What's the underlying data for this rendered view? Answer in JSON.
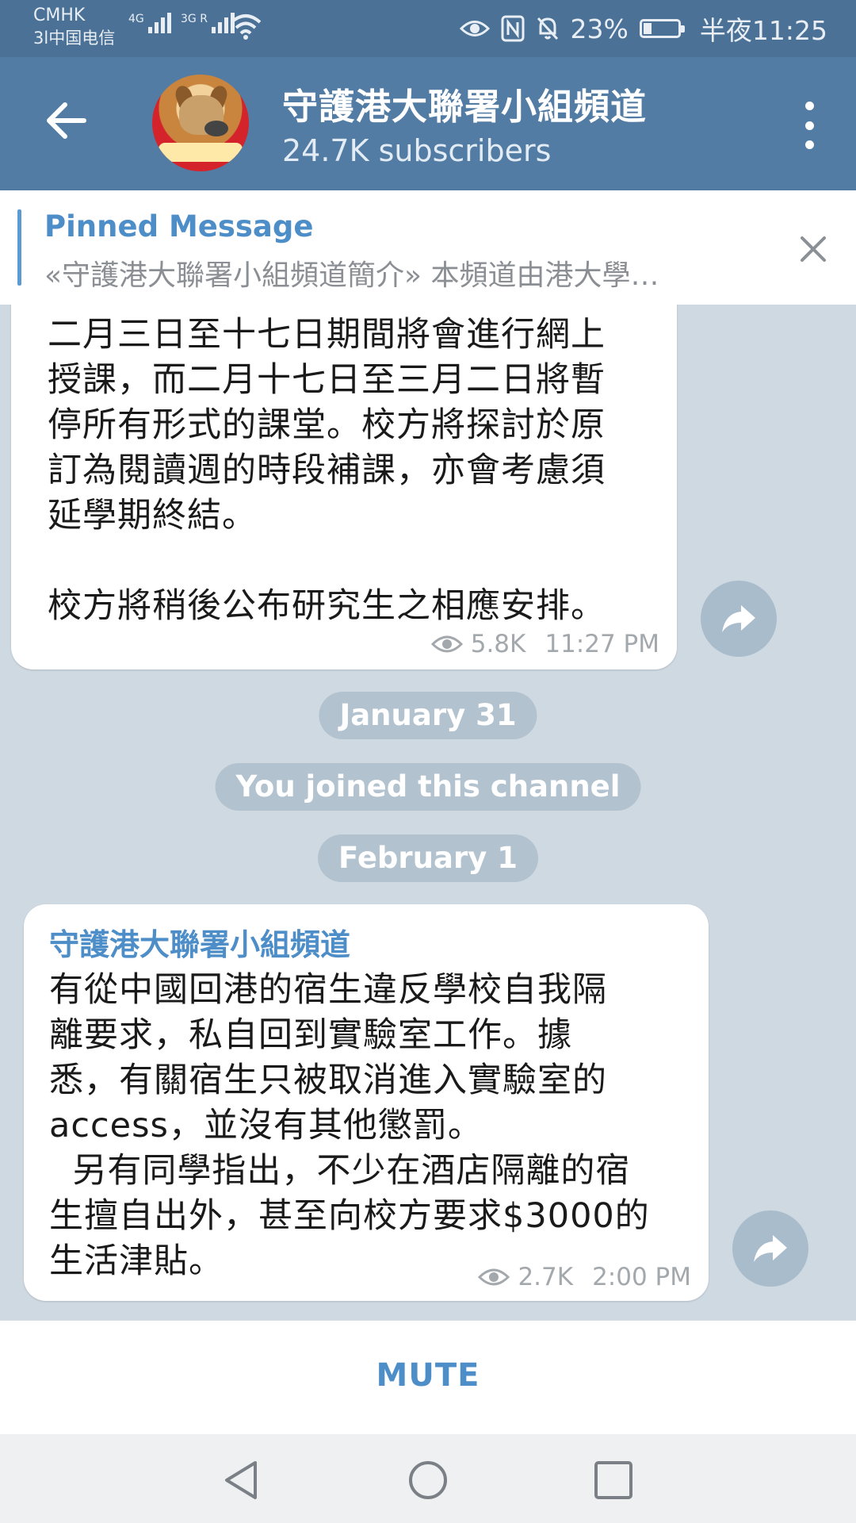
{
  "status_bar": {
    "carrier_1": "CMHK",
    "carrier_2": "3l中国电信",
    "signal_1": "4G",
    "signal_2": "3G R",
    "battery_percent": "23%",
    "battery_level": 0.23,
    "time": "半夜11:25"
  },
  "header": {
    "title": "守護港大聯署小組頻道",
    "subtitle": "24.7K subscribers"
  },
  "pinned": {
    "title": "Pinned Message",
    "text": "«守護港大聯署小組頻道簡介» 本頻道由港大學…"
  },
  "messages": [
    {
      "lines": [
        "二月三日至十七日期間將會進行網上",
        "授課，而二月十七日至三月二日將暫",
        "停所有形式的課堂。校方將探討於原",
        "訂為閱讀週的時段補課，亦會考慮須",
        "延學期終結。"
      ],
      "lines_2": [
        "校方將稍後公布研究生之相應安排。"
      ],
      "views": "5.8K",
      "time": "11:27 PM"
    },
    {
      "sender": "守護港大聯署小組頻道",
      "text": "有從中國回港的宿生違反學校自我隔\n離要求，私自回到實驗室工作。據\n悉，有關宿生只被取消進入實驗室的\naccess，並沒有其他懲罰。\n  另有同學指出，不少在酒店隔離的宿\n生擅自出外，甚至向校方要求$3000的\n生活津貼。",
      "views": "2.7K",
      "time": "2:00 PM"
    }
  ],
  "service": {
    "date_1": "January 31",
    "joined": "You joined this channel",
    "date_2": "February 1"
  },
  "footer": {
    "mute_label": "MUTE"
  },
  "colors": {
    "header": "#527ca3",
    "status_bar": "#4b7196",
    "accent": "#4e8ec8",
    "chat_bg": "#cfd9e2"
  },
  "icons": {
    "back": "arrow-left-icon",
    "more": "more-vertical-icon",
    "close": "close-icon",
    "views": "eye-icon",
    "share": "share-icon"
  }
}
